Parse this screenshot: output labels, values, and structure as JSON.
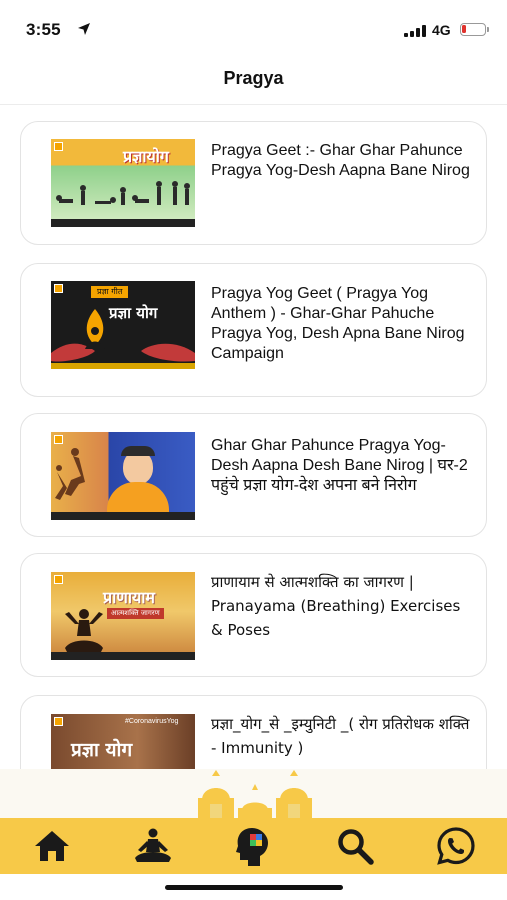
{
  "status_bar": {
    "time": "3:55",
    "network": "4G"
  },
  "nav": {
    "title": "Pragya"
  },
  "videos": [
    {
      "title": "Pragya Geet :- Ghar Ghar Pahunce Pragya Yog-Desh Aapna Bane Nirog",
      "thumb_text": "प्रज्ञायोग"
    },
    {
      "title": "Pragya Yog Geet ( Pragya Yog Anthem ) - Ghar-Ghar Pahuche Pragya Yog, Desh Apna Bane Nirog Campaign",
      "thumb_tag": "प्रज्ञा गीत",
      "thumb_text": "प्रज्ञा योग"
    },
    {
      "title": "Ghar Ghar Pahunce Pragya Yog-Desh Aapna Desh Bane Nirog | घर-2 पहुंचे प्रज्ञा योग-देश अपना बने निरोग"
    },
    {
      "title": "प्राणायाम से आत्मशक्ति का जागरण | Pranayama (Breathing) Exercises & Poses",
      "thumb_text": "प्राणायाम",
      "thumb_sub": "आत्मशक्ति जागरण"
    },
    {
      "title": "प्रज्ञा_योग_से _इम्युनिटी _( रोग प्रतिरोधक शक्ति - Immunity )",
      "thumb_tag": "#CoronavirusYog",
      "thumb_text": "प्रज्ञा योग"
    }
  ],
  "tabs": [
    {
      "icon": "home-icon"
    },
    {
      "icon": "meditation-icon"
    },
    {
      "icon": "mind-icon"
    },
    {
      "icon": "search-icon"
    },
    {
      "icon": "whatsapp-icon"
    }
  ],
  "colors": {
    "accent": "#f7c948",
    "card_border": "#e3e3e3",
    "battery_low": "#e0332e"
  }
}
